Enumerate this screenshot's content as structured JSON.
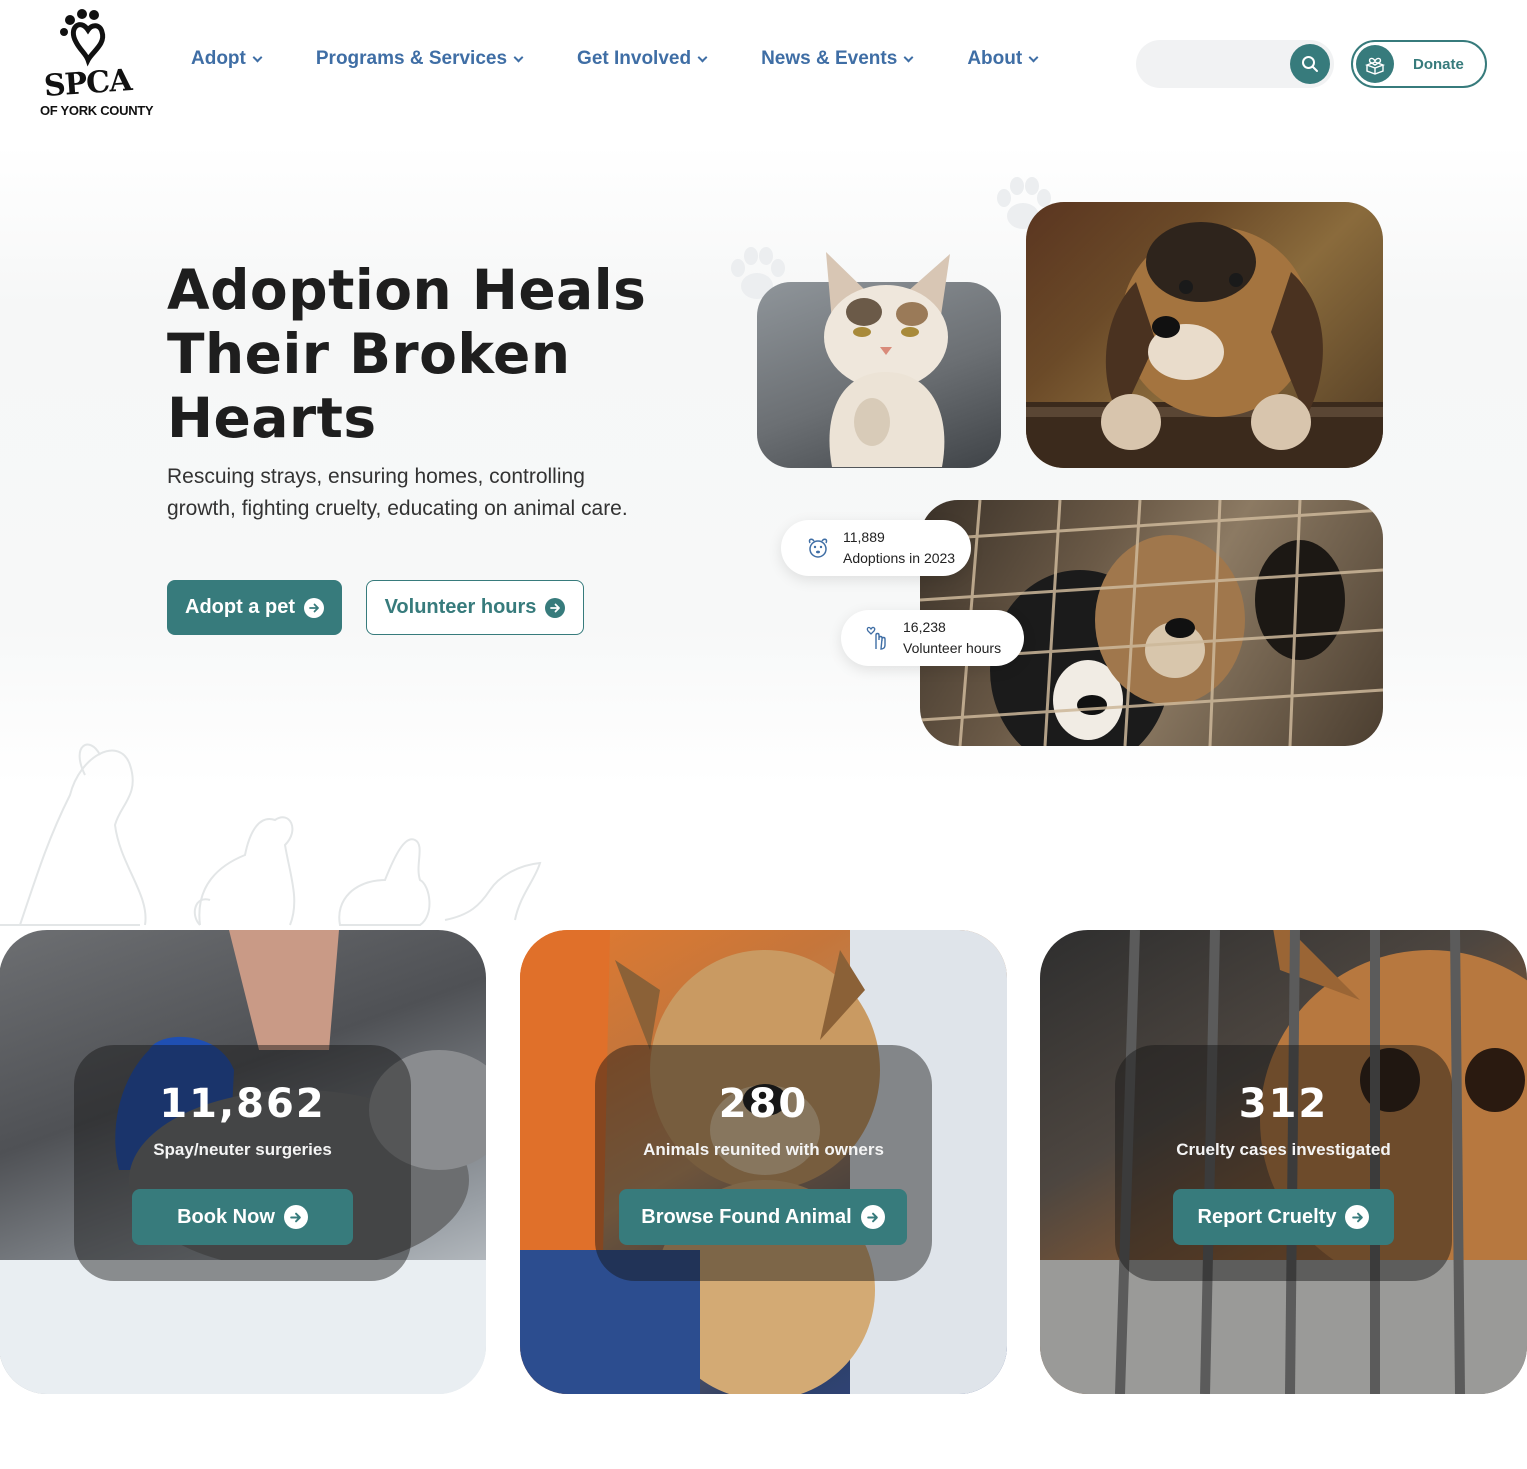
{
  "brand": {
    "logo_text": "SPCA",
    "logo_subtitle": "OF YORK COUNTY",
    "accent_color": "#377b7c",
    "nav_color": "#3f6ea5"
  },
  "nav": {
    "items": [
      {
        "label": "Adopt"
      },
      {
        "label": "Programs & Services"
      },
      {
        "label": "Get Involved"
      },
      {
        "label": "News & Events"
      },
      {
        "label": "About"
      }
    ]
  },
  "search": {
    "value": "",
    "icon": "search-icon"
  },
  "donate": {
    "label": "Donate",
    "icon": "gift-box-heart-icon"
  },
  "hero": {
    "title": "Adoption Heals Their Broken Hearts",
    "subtitle": "Rescuing strays, ensuring homes, controlling growth, fighting cruelty, educating on animal care.",
    "primary_button": "Adopt a pet",
    "secondary_button": "Volunteer hours"
  },
  "hero_stats": [
    {
      "value": "11,889",
      "label": "Adoptions in 2023",
      "icon": "dog-face-icon"
    },
    {
      "value": "16,238",
      "label": "Volunteer hours",
      "icon": "hand-heart-icon"
    }
  ],
  "cards": [
    {
      "number": "11,862",
      "label": "Spay/neuter surgeries",
      "button": "Book Now"
    },
    {
      "number": "280",
      "label": "Animals reunited with owners",
      "button": "Browse Found Animal"
    },
    {
      "number": "312",
      "label": "Cruelty cases investigated",
      "button": "Report Cruelty"
    }
  ]
}
